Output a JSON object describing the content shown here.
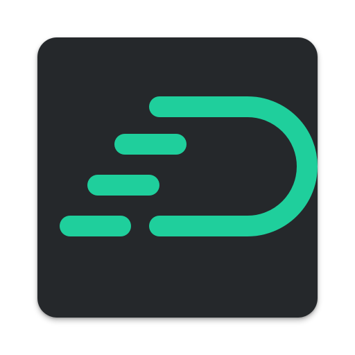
{
  "app_icon": {
    "icon": "speed-d-logo-icon",
    "colors": {
      "background": "#25282b",
      "accent": "#1fcf9c"
    }
  }
}
